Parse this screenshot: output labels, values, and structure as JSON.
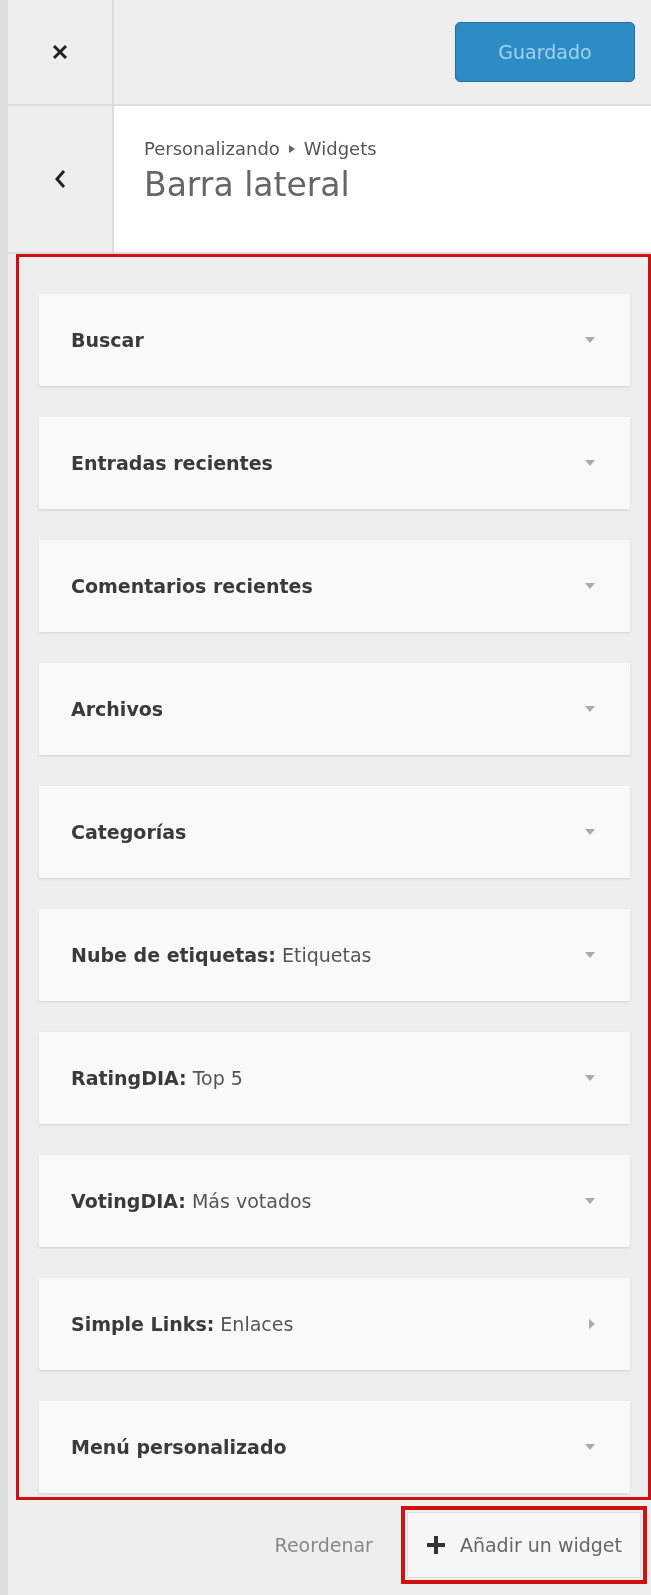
{
  "top_bar": {
    "save_button": "Guardado"
  },
  "header": {
    "breadcrumb": [
      "Personalizando",
      "Widgets"
    ],
    "title": "Barra lateral"
  },
  "widgets_area": {
    "highlighted": true,
    "widgets": [
      {
        "name": "Buscar",
        "arrow_right": false
      },
      {
        "name": "Entradas recientes",
        "arrow_right": false
      },
      {
        "name": "Comentarios recientes",
        "arrow_right": false
      },
      {
        "name": "Archivos",
        "arrow_right": false
      },
      {
        "name": "Categorías",
        "arrow_right": false
      },
      {
        "name": "Nube de etiquetas:",
        "title": "Etiquetas",
        "arrow_right": false
      },
      {
        "name": "RatingDIA:",
        "title": "Top 5",
        "arrow_right": false
      },
      {
        "name": "VotingDIA:",
        "title": "Más votados",
        "arrow_right": false
      },
      {
        "name": "Simple Links:",
        "title": "Enlaces",
        "arrow_right": true
      },
      {
        "name": "Menú personalizado",
        "arrow_right": false
      }
    ]
  },
  "footer": {
    "reorder_link": "Reordenar",
    "add_button": {
      "label": "Añadir un widget",
      "highlighted": true
    }
  }
}
